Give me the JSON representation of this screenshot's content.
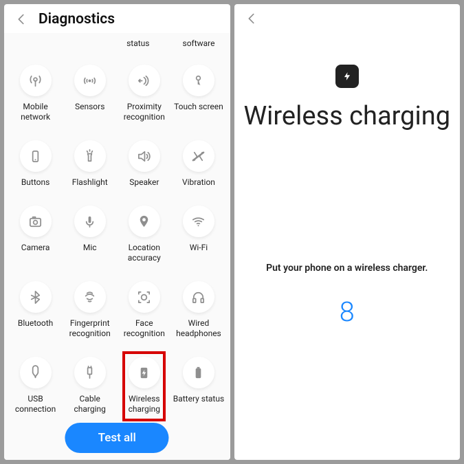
{
  "left": {
    "title": "Diagnostics",
    "sublabels": {
      "a": "status",
      "b": "software"
    },
    "items": [
      {
        "name": "mobile-network",
        "label": "Mobile network",
        "icon": "antenna-icon"
      },
      {
        "name": "sensors",
        "label": "Sensors",
        "icon": "sensors-icon"
      },
      {
        "name": "proximity",
        "label": "Proximity recognition",
        "icon": "proximity-icon"
      },
      {
        "name": "touch-screen",
        "label": "Touch screen",
        "icon": "touch-icon"
      },
      {
        "name": "buttons",
        "label": "Buttons",
        "icon": "buttons-icon"
      },
      {
        "name": "flashlight",
        "label": "Flashlight",
        "icon": "flashlight-icon"
      },
      {
        "name": "speaker",
        "label": "Speaker",
        "icon": "speaker-icon"
      },
      {
        "name": "vibration",
        "label": "Vibration",
        "icon": "vibration-icon"
      },
      {
        "name": "camera",
        "label": "Camera",
        "icon": "camera-icon"
      },
      {
        "name": "mic",
        "label": "Mic",
        "icon": "mic-icon"
      },
      {
        "name": "location-accuracy",
        "label": "Location accuracy",
        "icon": "location-icon"
      },
      {
        "name": "wifi",
        "label": "Wi-Fi",
        "icon": "wifi-icon"
      },
      {
        "name": "bluetooth",
        "label": "Bluetooth",
        "icon": "bluetooth-icon"
      },
      {
        "name": "fingerprint",
        "label": "Fingerprint recognition",
        "icon": "fingerprint-icon"
      },
      {
        "name": "face-recognition",
        "label": "Face recognition",
        "icon": "face-icon"
      },
      {
        "name": "wired-headphones",
        "label": "Wired headphones",
        "icon": "headphones-icon"
      },
      {
        "name": "usb-connection",
        "label": "USB connection",
        "icon": "usb-icon"
      },
      {
        "name": "cable-charging",
        "label": "Cable charging",
        "icon": "cable-charging-icon"
      },
      {
        "name": "wireless-charging",
        "label": "Wireless charging",
        "icon": "wireless-charging-icon",
        "highlighted": true
      },
      {
        "name": "battery-status",
        "label": "Battery status",
        "icon": "battery-icon"
      }
    ],
    "test_all": "Test all"
  },
  "right": {
    "title": "Wireless charging",
    "instruction": "Put your phone on a wireless charger.",
    "countdown": "8"
  }
}
